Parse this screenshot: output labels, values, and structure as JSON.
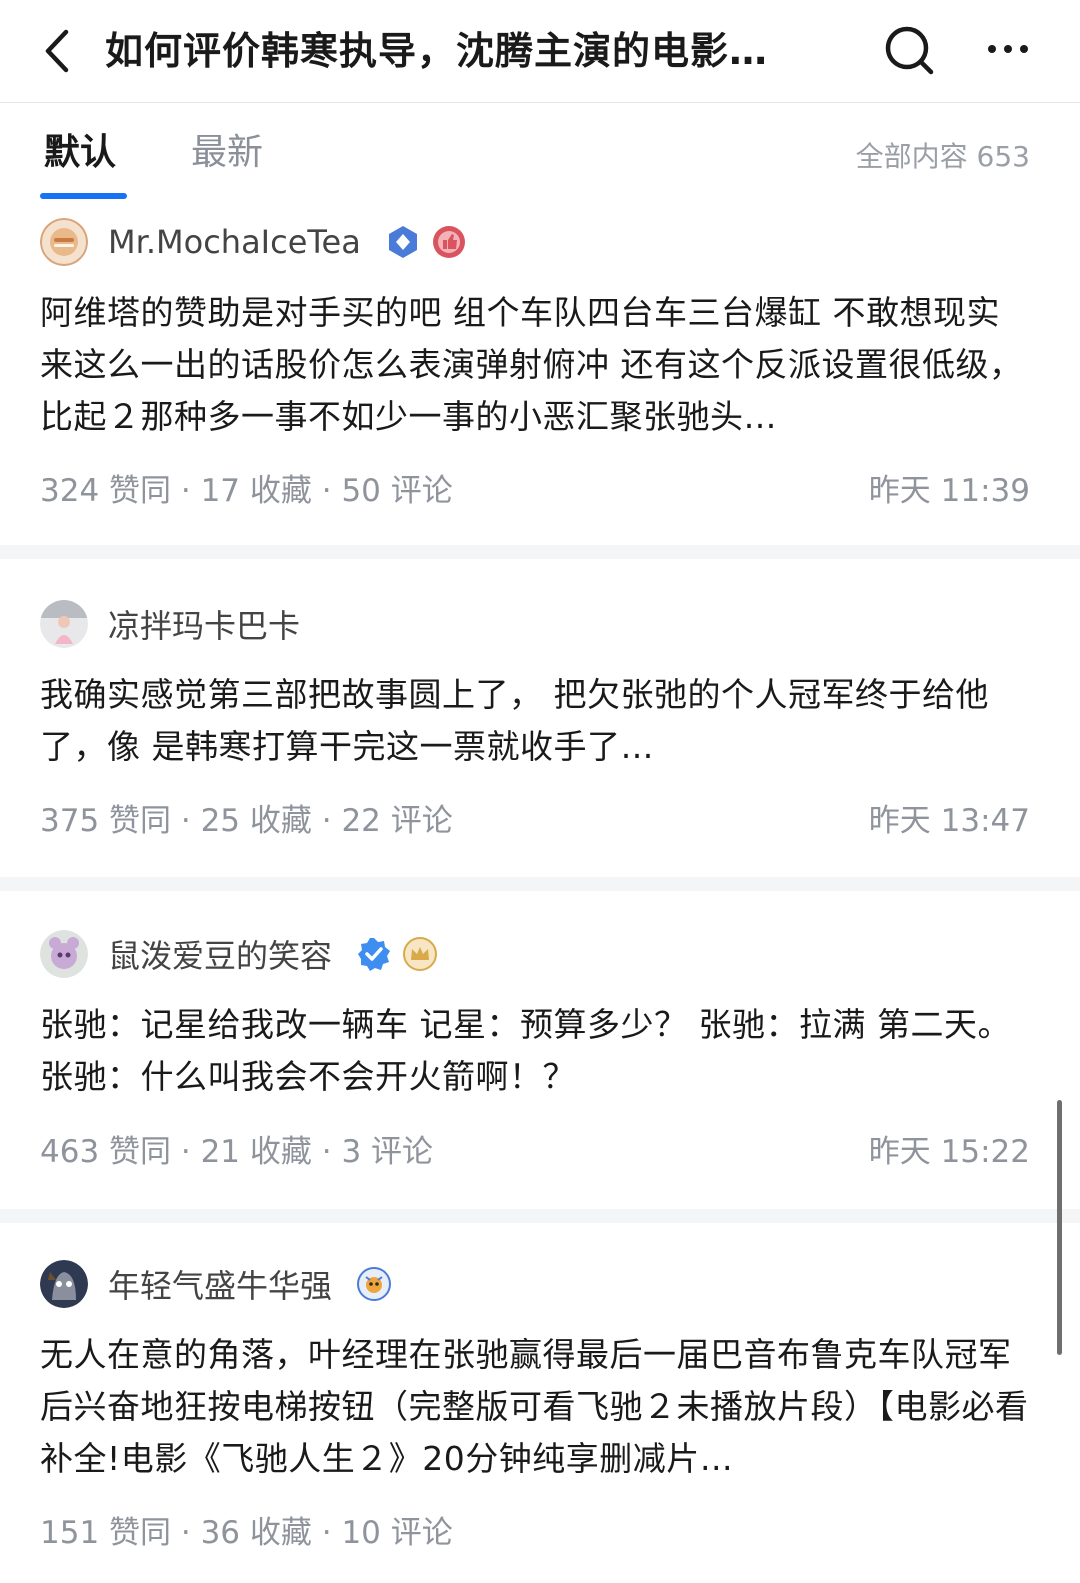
{
  "header": {
    "title": "如何评价韩寒执导，沈腾主演的电影…"
  },
  "tabs": {
    "default_label": "默认",
    "latest_label": "最新",
    "total_label": "全部内容 653"
  },
  "answers": [
    {
      "author": "Mr.MochaIceTea",
      "badges": [
        "verified-blue-icon",
        "thumbs-up-badge-icon"
      ],
      "content": "阿维塔的赞助是对手买的吧 组个车队四台车三台爆缸 不敢想现实来这么一出的话股价怎么表演弹射俯冲 还有这个反派设置很低级，比起２那种多一事不如少一事的小恶汇聚张驰头…",
      "meta": "324 赞同 · 17 收藏 · 50 评论",
      "time": "昨天 11:39"
    },
    {
      "author": "凉拌玛卡巴卡",
      "badges": [],
      "content": "我确实感觉第三部把故事圆上了， 把欠张弛的个人冠军终于给他了，像 是韩寒打算干完这一票就收手了…",
      "meta": "375 赞同 · 25 收藏 · 22 评论",
      "time": "昨天 13:47"
    },
    {
      "author": "鼠泼爱豆的笑容",
      "badges": [
        "verified-check-icon",
        "crown-badge-icon"
      ],
      "content": "张驰：记星给我改一辆车 记星：预算多少？ 张驰：拉满 第二天。 张驰：什么叫我会不会开火箭啊！？",
      "meta": "463 赞同 · 21 收藏 · 3 评论",
      "time": "昨天 15:22"
    },
    {
      "author": "年轻气盛牛华强",
      "badges": [
        "creator-badge-icon"
      ],
      "content": "无人在意的角落，叶经理在张驰赢得最后一届巴音布鲁克车队冠军后兴奋地狂按电梯按钮（完整版可看飞驰２未播放片段）【电影必看补全!电影《飞驰人生２》20分钟纯享删减片…",
      "meta": "151 赞同 · 36 收藏 · 10 评论"
    }
  ],
  "colors": {
    "accent": "#1772f6",
    "muted": "#8f949c",
    "separator": "#f4f5f7"
  }
}
